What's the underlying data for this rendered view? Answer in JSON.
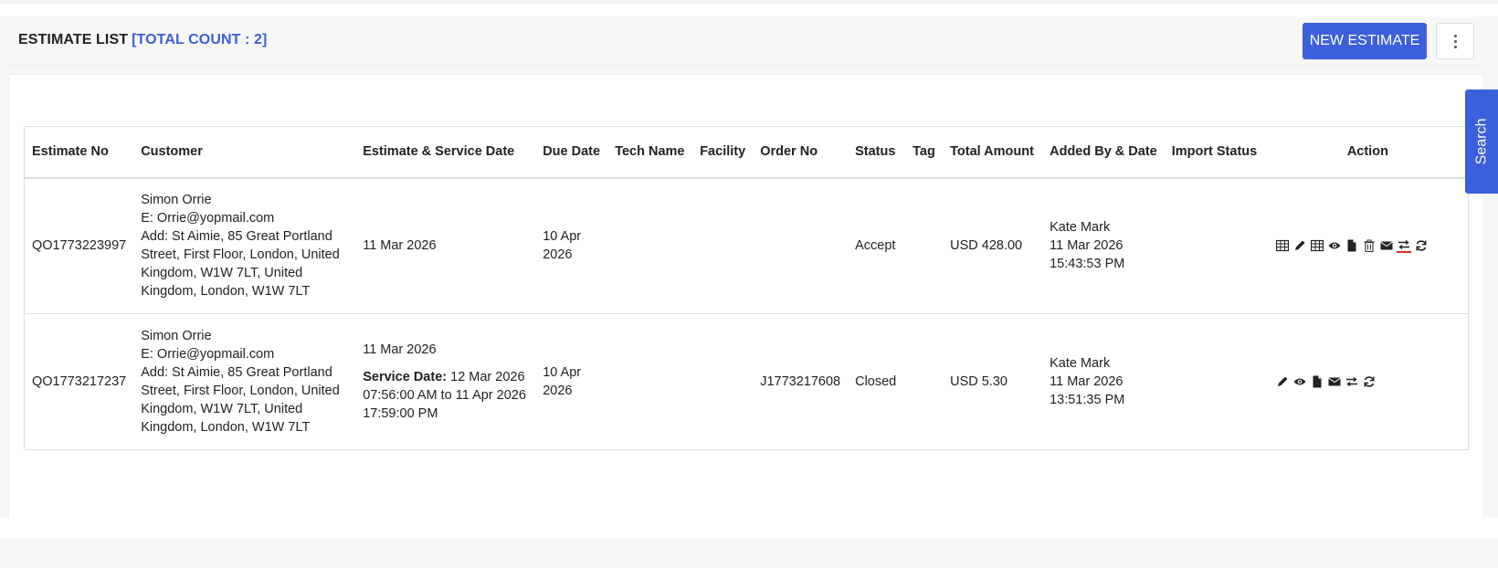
{
  "header": {
    "title": "ESTIMATE LIST",
    "count_label": "[TOTAL COUNT : 2]",
    "new_button": "NEW ESTIMATE",
    "more_icon": "more-vertical-icon"
  },
  "search_tab": "Search",
  "table": {
    "columns": [
      "Estimate No",
      "Customer",
      "Estimate & Service Date",
      "Due Date",
      "Tech Name",
      "Facility",
      "Order No",
      "Status",
      "Tag",
      "Total Amount",
      "Added By & Date",
      "Import Status",
      "Action"
    ],
    "rows": [
      {
        "estimate_no": "QO1773223997",
        "customer_name": "Simon Orrie",
        "customer_email": "E: Orrie@yopmail.com",
        "customer_address": "Add: St Aimie, 85 Great Portland Street, First Floor, London, United Kingdom, W1W 7LT, United Kingdom, London, W1W 7LT",
        "estimate_date": "11 Mar 2026",
        "service_label": "",
        "service_date": "",
        "due_date": "10 Apr 2026",
        "tech_name": "",
        "facility": "",
        "order_no": "",
        "status": "Accept",
        "tag": "",
        "total_amount": "USD 428.00",
        "added_by": "Kate Mark",
        "added_date": "11 Mar 2026",
        "added_time": "15:43:53 PM",
        "import_status": "",
        "actions": [
          "table-icon",
          "pencil-icon",
          "table-icon",
          "eye-icon",
          "file-icon",
          "trash-icon",
          "envelope-icon",
          "exchange-icon",
          "refresh-icon"
        ]
      },
      {
        "estimate_no": "QO1773217237",
        "customer_name": "Simon Orrie",
        "customer_email": "E: Orrie@yopmail.com",
        "customer_address": "Add: St Aimie, 85 Great Portland Street, First Floor, London, United Kingdom, W1W 7LT, United Kingdom, London, W1W 7LT",
        "estimate_date": "11 Mar 2026",
        "service_label": "Service Date:",
        "service_date": "12 Mar 2026 07:56:00 AM to 11 Apr 2026 17:59:00 PM",
        "due_date": "10 Apr 2026",
        "tech_name": "",
        "facility": "",
        "order_no": "J1773217608",
        "status": "Closed",
        "tag": "",
        "total_amount": "USD 5.30",
        "added_by": "Kate Mark",
        "added_date": "11 Mar 2026",
        "added_time": "13:51:35 PM",
        "import_status": "",
        "actions": [
          "pencil-icon",
          "eye-icon",
          "file-icon",
          "envelope-icon",
          "exchange-icon",
          "refresh-icon"
        ]
      }
    ]
  },
  "colors": {
    "primary": "#3c5fdc",
    "count_text": "#3d5fd9",
    "highlight_underline": "#d62d2d"
  }
}
